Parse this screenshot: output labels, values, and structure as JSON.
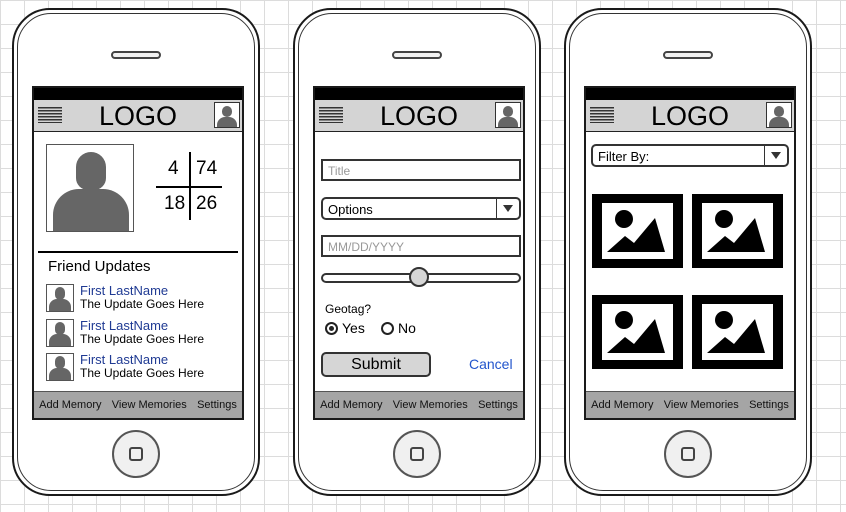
{
  "header": {
    "logo": "LOGO"
  },
  "tabbar": {
    "items": [
      "Add Memory",
      "View Memories",
      "Settings"
    ]
  },
  "profile": {
    "stats": {
      "top_left": "4",
      "top_right": "74",
      "bottom_left": "18",
      "bottom_right": "26"
    },
    "friend_updates": {
      "title": "Friend Updates",
      "items": [
        {
          "name": "First LastName",
          "update": "The Update Goes Here"
        },
        {
          "name": "First LastName",
          "update": "The Update Goes Here"
        },
        {
          "name": "First LastName",
          "update": "The Update Goes Here"
        }
      ]
    }
  },
  "form": {
    "title_placeholder": "Title",
    "options_value": "Options",
    "date_placeholder": "MM/DD/YYYY",
    "slider_value": 0.5,
    "geotag_label": "Geotag?",
    "yes_label": "Yes",
    "no_label": "No",
    "geotag_selected": "Yes",
    "submit_label": "Submit",
    "cancel_label": "Cancel"
  },
  "gallery": {
    "filter_label": "Filter By:"
  },
  "colors": {
    "link": "#1f3a93",
    "cancel": "#2255cc",
    "header_bg": "#d4d4d4",
    "tabbar_bg": "#a5a5a5"
  }
}
